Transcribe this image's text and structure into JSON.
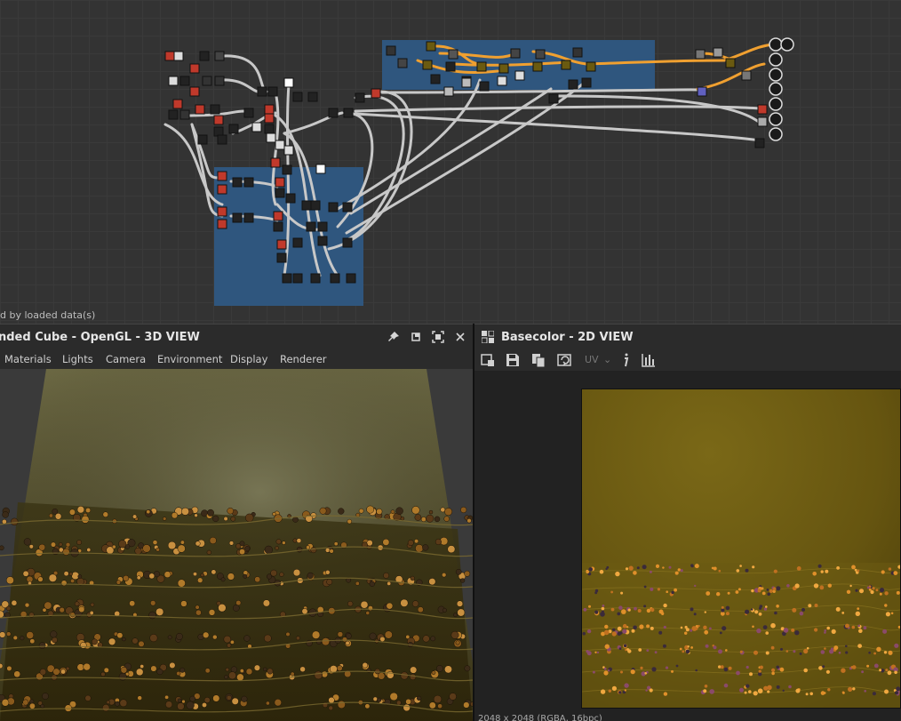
{
  "graph": {
    "status_text": "d by loaded data(s)"
  },
  "view3d": {
    "title": "nded Cube - OpenGL - 3D VIEW",
    "menu": [
      "Materials",
      "Lights",
      "Camera",
      "Environment",
      "Display",
      "Renderer"
    ],
    "header_icons": [
      "pin-icon",
      "restore-icon",
      "maximize-icon",
      "close-icon"
    ]
  },
  "view2d": {
    "title": "Basecolor - 2D VIEW",
    "toolbar": {
      "icons": [
        "export-view-icon",
        "save-icon",
        "copy-icon",
        "refresh-icon",
        "info-icon",
        "histogram-icon"
      ],
      "uv_label": "UV",
      "uv_chevron": "⌄"
    },
    "resolution_text": "2048 x 2048 (RGBA, 16bpc)"
  },
  "colors": {
    "graph_bg": "#333333",
    "frame_blue": "#2f5a86",
    "wire_grey": "#c8c8c8",
    "wire_orange": "#f0a030",
    "texture_gold": "#6b5a12"
  }
}
